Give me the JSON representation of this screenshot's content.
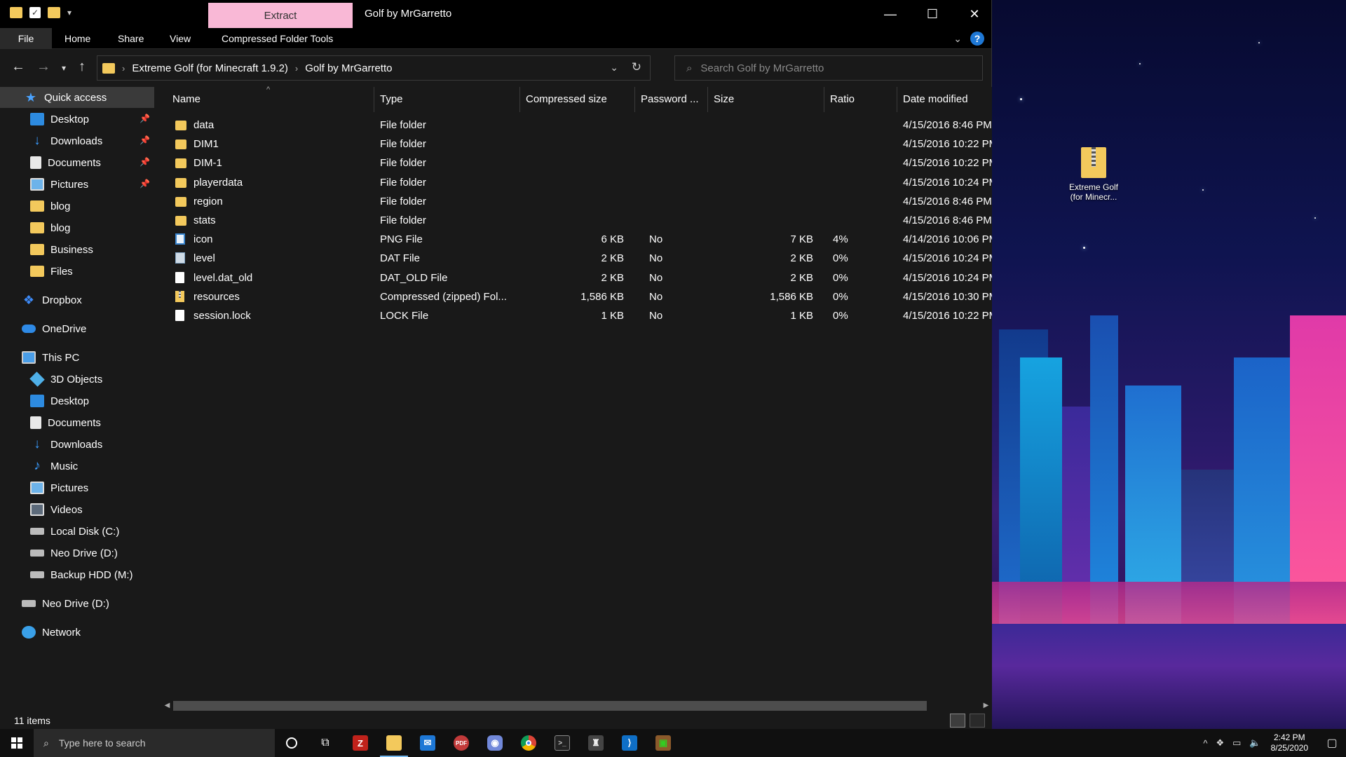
{
  "titlebar": {
    "extract_tab": "Extract",
    "window_title": "Golf by MrGarretto",
    "minimize": "—",
    "maximize": "☐",
    "close": "✕"
  },
  "ribbon": {
    "tabs": [
      "File",
      "Home",
      "Share",
      "View",
      "Compressed Folder Tools"
    ],
    "help": "?"
  },
  "address": {
    "crumbs": [
      "Extreme Golf (for Minecraft 1.9.2)",
      "Golf by MrGarretto"
    ],
    "search_placeholder": "Search Golf by MrGarretto"
  },
  "sidebar": {
    "quick_access": "Quick access",
    "quick_items": [
      "Desktop",
      "Downloads",
      "Documents",
      "Pictures",
      "blog",
      "blog",
      "Business",
      "Files"
    ],
    "dropbox": "Dropbox",
    "onedrive": "OneDrive",
    "this_pc": "This PC",
    "pc_items": [
      "3D Objects",
      "Desktop",
      "Documents",
      "Downloads",
      "Music",
      "Pictures",
      "Videos",
      "Local Disk (C:)",
      "Neo Drive (D:)",
      "Backup HDD (M:)"
    ],
    "neo_drive": "Neo Drive (D:)",
    "network": "Network"
  },
  "columns": [
    "Name",
    "Type",
    "Compressed size",
    "Password ...",
    "Size",
    "Ratio",
    "Date modified"
  ],
  "files": [
    {
      "name": "data",
      "type": "File folder",
      "csize": "",
      "password": "",
      "size": "",
      "ratio": "",
      "date": "4/15/2016 8:46 PM",
      "icon": "folder"
    },
    {
      "name": "DIM1",
      "type": "File folder",
      "csize": "",
      "password": "",
      "size": "",
      "ratio": "",
      "date": "4/15/2016 10:22 PM",
      "icon": "folder"
    },
    {
      "name": "DIM-1",
      "type": "File folder",
      "csize": "",
      "password": "",
      "size": "",
      "ratio": "",
      "date": "4/15/2016 10:22 PM",
      "icon": "folder"
    },
    {
      "name": "playerdata",
      "type": "File folder",
      "csize": "",
      "password": "",
      "size": "",
      "ratio": "",
      "date": "4/15/2016 10:24 PM",
      "icon": "folder"
    },
    {
      "name": "region",
      "type": "File folder",
      "csize": "",
      "password": "",
      "size": "",
      "ratio": "",
      "date": "4/15/2016 8:46 PM",
      "icon": "folder"
    },
    {
      "name": "stats",
      "type": "File folder",
      "csize": "",
      "password": "",
      "size": "",
      "ratio": "",
      "date": "4/15/2016 8:46 PM",
      "icon": "folder"
    },
    {
      "name": "icon",
      "type": "PNG File",
      "csize": "6 KB",
      "password": "No",
      "size": "7 KB",
      "ratio": "4%",
      "date": "4/14/2016 10:06 PM",
      "icon": "png"
    },
    {
      "name": "level",
      "type": "DAT File",
      "csize": "2 KB",
      "password": "No",
      "size": "2 KB",
      "ratio": "0%",
      "date": "4/15/2016 10:24 PM",
      "icon": "dat"
    },
    {
      "name": "level.dat_old",
      "type": "DAT_OLD File",
      "csize": "2 KB",
      "password": "No",
      "size": "2 KB",
      "ratio": "0%",
      "date": "4/15/2016 10:24 PM",
      "icon": "file"
    },
    {
      "name": "resources",
      "type": "Compressed (zipped) Fol...",
      "csize": "1,586 KB",
      "password": "No",
      "size": "1,586 KB",
      "ratio": "0%",
      "date": "4/15/2016 10:30 PM",
      "icon": "zip"
    },
    {
      "name": "session.lock",
      "type": "LOCK File",
      "csize": "1 KB",
      "password": "No",
      "size": "1 KB",
      "ratio": "0%",
      "date": "4/15/2016 10:22 PM",
      "icon": "file"
    }
  ],
  "status": {
    "items": "11 items"
  },
  "desktop": {
    "icon_label_1": "Extreme Golf",
    "icon_label_2": "(for Minecr..."
  },
  "taskbar": {
    "search_placeholder": "Type here to search",
    "time": "2:42 PM",
    "date": "8/25/2020"
  }
}
